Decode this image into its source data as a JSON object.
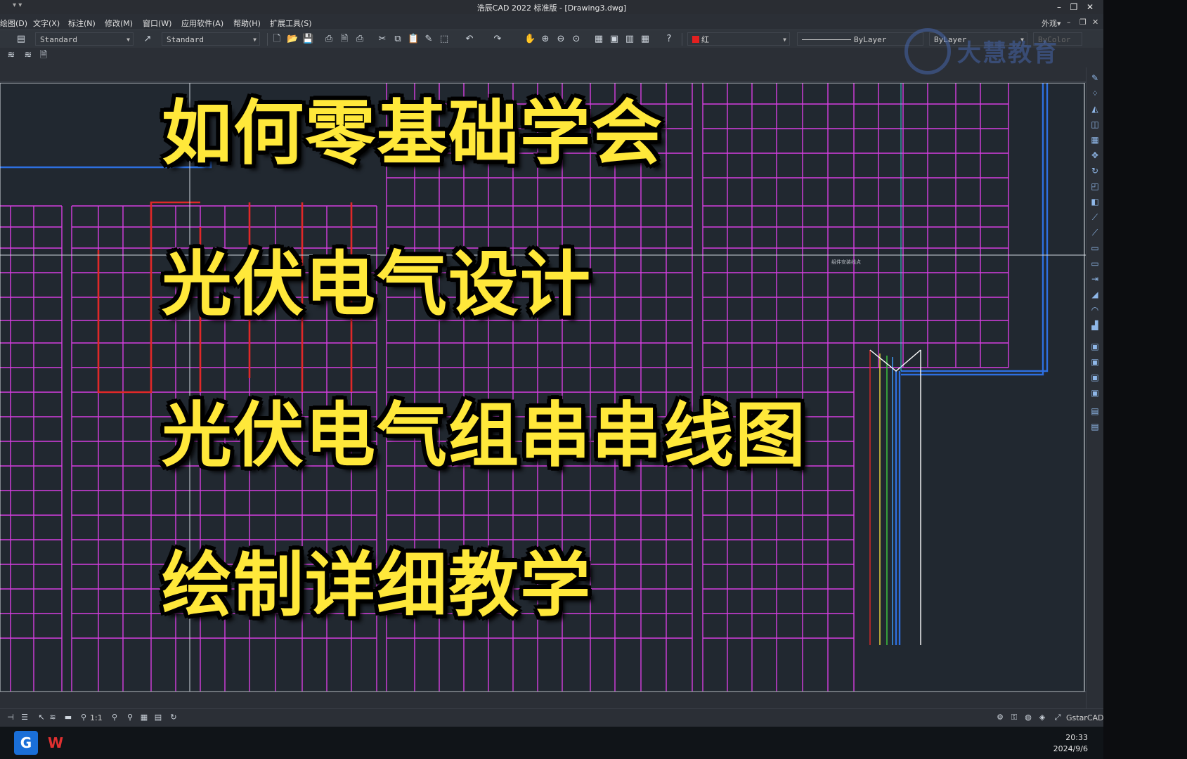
{
  "window": {
    "title": "浩辰CAD 2022 标准版 - [Drawing3.dwg]",
    "quick_access": "▾  ▾"
  },
  "menu": {
    "items": [
      "绘图(D)",
      "文字(X)",
      "标注(N)",
      "修改(M)",
      "窗口(W)",
      "应用软件(A)",
      "帮助(H)",
      "扩展工具(S)"
    ],
    "appearance": "外观▾"
  },
  "toolbar": {
    "text_style": "Standard",
    "dim_style": "Standard",
    "color": "红",
    "color_hex": "#e32020",
    "linetype": "ByLayer",
    "lineweight": "ByLayer",
    "plotstyle": "ByColor"
  },
  "watermark": {
    "text": "大慧教育"
  },
  "caption": {
    "line1": "如何零基础学会",
    "line2": "光伏电气设计",
    "line3": "光伏电气组串串线图",
    "line4": "绘制详细教学",
    "color": "#ffe83a"
  },
  "drawing": {
    "note": "组件安装线点",
    "grid_color": "#d63ee0",
    "string_color": "#e02828",
    "cable_color": "#2d6fe0"
  },
  "statusbar": {
    "scale": "1:1",
    "brand": "GstarCAD"
  },
  "taskbar": {
    "apps": [
      {
        "icon": "gstarcad-icon",
        "label": "G"
      },
      {
        "icon": "wps-icon",
        "label": "W"
      }
    ],
    "time": "20:33",
    "date": "2024/9/6"
  }
}
